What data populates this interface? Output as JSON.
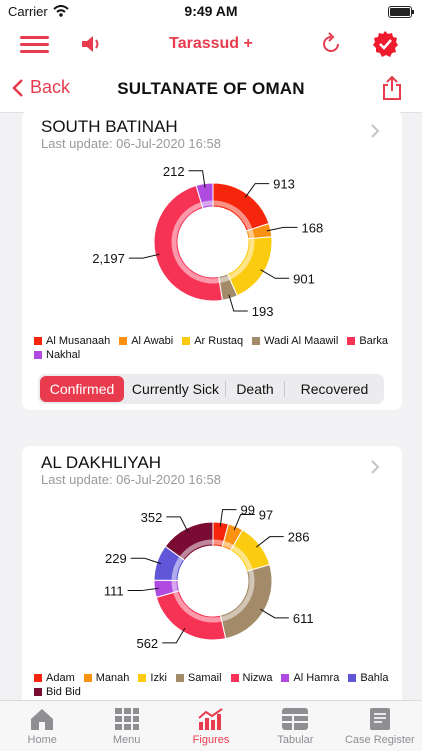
{
  "status": {
    "carrier": "Carrier",
    "time": "9:49 AM"
  },
  "app": {
    "title": "Tarassud +"
  },
  "nav": {
    "back_label": "Back",
    "title": "SULTANATE OF OMAN"
  },
  "colors": {
    "accent": "#e83c4e"
  },
  "cards": [
    {
      "title": "SOUTH BATINAH",
      "last_update": "Last update:  06-Jul-2020 16:58",
      "legend": [
        "Al Musanaah",
        "Al Awabi",
        "Ar Rustaq",
        "Wadi Al Maawil",
        "Barka",
        "Nakhal"
      ],
      "segments": [
        "Confirmed",
        "Currently Sick",
        "Death",
        "Recovered"
      ],
      "selected_segment": "Confirmed"
    },
    {
      "title": "AL DAKHLIYAH",
      "last_update": "Last update:  06-Jul-2020 16:58",
      "legend": [
        "Adam",
        "Manah",
        "Izki",
        "Samail",
        "Nizwa",
        "Al Hamra",
        "Bahla",
        "Bid Bid"
      ]
    }
  ],
  "chart_data": [
    {
      "type": "pie",
      "categories": [
        "Al Musanaah",
        "Al Awabi",
        "Ar Rustaq",
        "Wadi Al Maawil",
        "Barka",
        "Nakhal"
      ],
      "values": [
        913,
        168,
        901,
        193,
        2197,
        212
      ],
      "labels": [
        "913",
        "168",
        "901",
        "193",
        "2,197",
        "212"
      ],
      "colors": [
        "#f5260c",
        "#fa9111",
        "#fbcb0f",
        "#a38b6a",
        "#f73355",
        "#b04be1"
      ]
    },
    {
      "type": "pie",
      "categories": [
        "Adam",
        "Manah",
        "Izki",
        "Samail",
        "Nizwa",
        "Al Hamra",
        "Bahla",
        "Bid Bid"
      ],
      "values": [
        99,
        97,
        286,
        611,
        562,
        111,
        229,
        352
      ],
      "labels": [
        "99",
        "97",
        "286",
        "611",
        "562",
        "111",
        "229",
        "352"
      ],
      "colors": [
        "#f5260c",
        "#fa9111",
        "#fbcb0f",
        "#a38b6a",
        "#f73355",
        "#b04be1",
        "#5f57d8",
        "#7a0c34"
      ]
    }
  ],
  "tabs": [
    {
      "label": "Home",
      "icon": "home-icon"
    },
    {
      "label": "Menu",
      "icon": "grid-icon"
    },
    {
      "label": "Figures",
      "icon": "bar-chart-icon"
    },
    {
      "label": "Tabular",
      "icon": "table-icon"
    },
    {
      "label": "Case Register",
      "icon": "clipboard-icon"
    }
  ]
}
